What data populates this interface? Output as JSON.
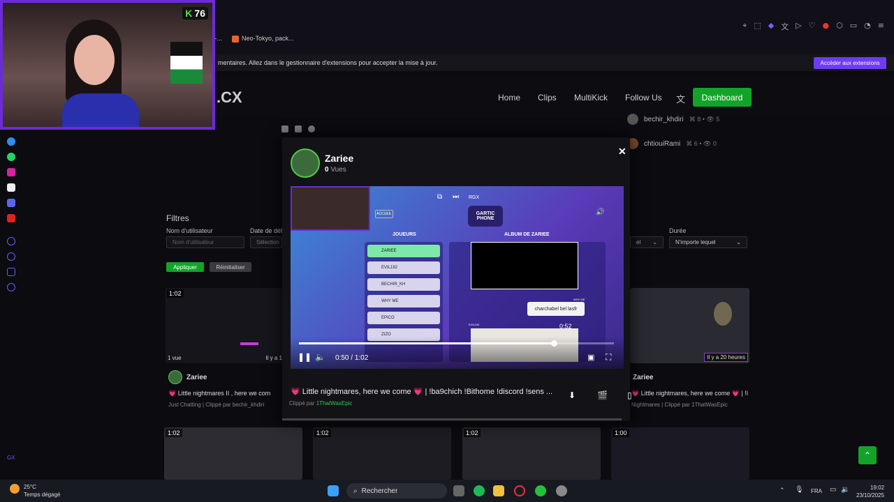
{
  "webcam": {
    "badge_value": "76"
  },
  "browser": {
    "tabs_partial": "e -...",
    "tab_neo": "Neo-Tokyo, pack...",
    "notification_text": "mentaires. Allez dans le gestionnaire d'extensions pour accepter la mise à jour.",
    "notification_button": "Accéder aux extensions"
  },
  "site": {
    "logo_partial": ".CX",
    "nav": {
      "home": "Home",
      "clips": "Clips",
      "multikick": "MultiKick",
      "follow": "Follow Us",
      "dashboard": "Dashboard"
    },
    "side_users": [
      {
        "name": "bechir_khdiri",
        "stats": "⌘ 8 • 👁 5"
      },
      {
        "name": "chtiouiRami",
        "stats": "⌘ 6 • 👁 0"
      }
    ]
  },
  "filters": {
    "title": "Filtres",
    "username_label": "Nom d'utilisateur",
    "username_placeholder": "Nom d'utilisateur",
    "date_label": "Date de déb",
    "date_value": "Sélection",
    "duration_label": "Durée",
    "duration_value": "N'importe lequel",
    "left_select_value": "el",
    "apply": "Appliquer",
    "reset": "Réinitialiser"
  },
  "cards": {
    "left": {
      "duration": "1:02",
      "views": "1 vue",
      "ago": "Il y a 1 ",
      "user": "Zariee",
      "title": "💗 Little nightmares II , here we com",
      "meta": "Just Chatting | Clippé par bechir_khdiri"
    },
    "right": {
      "ago": "Il y a 20 heures",
      "user": "Zariee",
      "title": "💗 Little nightmares, here we come 💗 | !l",
      "meta": "Nightmares | Clippé par 1ThatWasEpic"
    },
    "row2": [
      {
        "duration": "1:02"
      },
      {
        "duration": "1:02"
      },
      {
        "duration": "1:02"
      },
      {
        "duration": "1:00"
      }
    ]
  },
  "modal": {
    "name": "Zariee",
    "views_count": "0",
    "views_label": "Vues",
    "title": "💗 Little nightmares, here we come 💗 | !ba9chich !Bithome !discord !sens ...",
    "clipper_prefix": "Clippé par",
    "clipper": "1ThatWasEpic",
    "player": {
      "current": "0:50",
      "total": "1:02",
      "hover_time": "0:52",
      "progress": 0.81
    },
    "game": {
      "logo": "GARTIC PHONE",
      "players_header": "JOUEURS",
      "album_header": "ALBUM DE ZARIEE",
      "players": [
        "ZARIEE",
        "EVIL192",
        "BECHIR_KH",
        "WHY ME",
        "EPICO",
        "ZIZO"
      ],
      "chat_bubble": "charchabel bel lasfr",
      "chat_name_1": "WHY ME",
      "chat_name_2": "EVIL192",
      "accueil": "ACCUEIL",
      "rgx": "RGX"
    }
  },
  "taskbar": {
    "temp": "25°C",
    "weather": "Temps dégagé",
    "search": "Rechercher",
    "lang": "FRA",
    "time": "19:02",
    "date": "23/10/2025"
  },
  "rail": {
    "gx": "GX"
  }
}
